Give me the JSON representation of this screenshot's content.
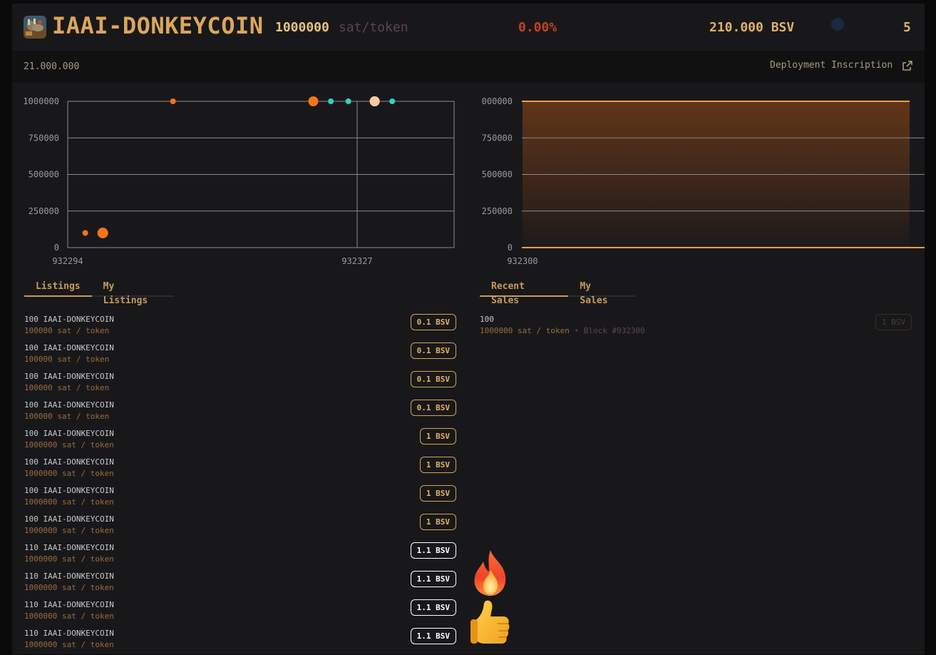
{
  "header": {
    "title": "IAAI-DONKEYCOIN",
    "price": "1000000",
    "price_unit": "sat/token",
    "change": "0.00%",
    "market_cap": "210.000 BSV",
    "holders": "5"
  },
  "subbar": {
    "supply": "21.000.000",
    "deploy_label": "Deployment Inscription",
    "deploy_icon": "external-link-icon"
  },
  "colors": {
    "accent": "#dba758",
    "negative": "#c2421f",
    "listing_dot": "#f97316",
    "sale_dot": "#2dd4bf",
    "muted": "#5e4450"
  },
  "chart_data": [
    {
      "type": "scatter",
      "title": "",
      "y_ticks": [
        "1000000",
        "750000",
        "500000",
        "250000",
        "0"
      ],
      "x_ticks": [
        "932294",
        "932327"
      ],
      "ylim": [
        0,
        1000000
      ],
      "series": [
        {
          "values": [
            {
              "x": 932296,
              "y": 100000
            },
            {
              "x": 932298,
              "y": 100000
            },
            {
              "x": 932306,
              "y": 1000000
            },
            {
              "x": 932322,
              "y": 1000000
            },
            {
              "x": 932329,
              "y": 1000000
            }
          ]
        },
        {
          "values": [
            {
              "x": 932324,
              "y": 1000000
            },
            {
              "x": 932326,
              "y": 1000000
            },
            {
              "x": 932329,
              "y": 1000000
            },
            {
              "x": 932331,
              "y": 1000000
            }
          ]
        }
      ]
    },
    {
      "type": "area",
      "title": "",
      "y_ticks": [
        "000000",
        "750000",
        "500000",
        "250000",
        "0"
      ],
      "x_ticks": [
        "932300"
      ],
      "ylim": [
        0,
        1000000
      ],
      "series": [
        {
          "values": [
            {
              "x": 932300,
              "y": 1000000
            }
          ]
        }
      ]
    }
  ],
  "listings": {
    "tabs": [
      "Listings",
      "My Listings"
    ],
    "items": [
      {
        "title": "100 IAAI-DONKEYCOIN",
        "sub": "100000 sat / token",
        "price": "0.1 BSV",
        "style": "gold"
      },
      {
        "title": "100 IAAI-DONKEYCOIN",
        "sub": "100000 sat / token",
        "price": "0.1 BSV",
        "style": "gold"
      },
      {
        "title": "100 IAAI-DONKEYCOIN",
        "sub": "100000 sat / token",
        "price": "0.1 BSV",
        "style": "gold"
      },
      {
        "title": "100 IAAI-DONKEYCOIN",
        "sub": "100000 sat / token",
        "price": "0.1 BSV",
        "style": "gold"
      },
      {
        "title": "100 IAAI-DONKEYCOIN",
        "sub": "1000000 sat / token",
        "price": "1 BSV",
        "style": "gold"
      },
      {
        "title": "100 IAAI-DONKEYCOIN",
        "sub": "1000000 sat / token",
        "price": "1 BSV",
        "style": "gold"
      },
      {
        "title": "100 IAAI-DONKEYCOIN",
        "sub": "1000000 sat / token",
        "price": "1 BSV",
        "style": "gold"
      },
      {
        "title": "100 IAAI-DONKEYCOIN",
        "sub": "1000000 sat / token",
        "price": "1 BSV",
        "style": "gold"
      },
      {
        "title": "110 IAAI-DONKEYCOIN",
        "sub": "1000000 sat / token",
        "price": "1.1 BSV",
        "style": "white"
      },
      {
        "title": "110 IAAI-DONKEYCOIN",
        "sub": "1000000 sat / token",
        "price": "1.1 BSV",
        "style": "white"
      },
      {
        "title": "110 IAAI-DONKEYCOIN",
        "sub": "1000000 sat / token",
        "price": "1.1 BSV",
        "style": "white"
      },
      {
        "title": "110 IAAI-DONKEYCOIN",
        "sub": "1000000 sat / token",
        "price": "1.1 BSV",
        "style": "white"
      }
    ]
  },
  "sales": {
    "tabs": [
      "Recent Sales",
      "My Sales"
    ],
    "items": [
      {
        "title": "100",
        "sub": "1000000 sat / token",
        "block": "• Block #932300",
        "price": "1 BSV"
      }
    ]
  },
  "decorations": {
    "emoji_1": "fire-emoji-icon",
    "emoji_2": "thumbs-up-emoji-icon"
  }
}
